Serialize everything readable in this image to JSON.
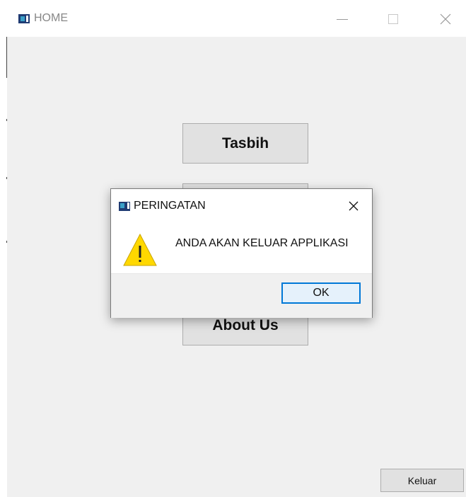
{
  "window": {
    "title": "HOME",
    "icon": "app-window-icon",
    "controls": [
      "minimize-icon",
      "maximize-icon",
      "close-icon"
    ]
  },
  "main": {
    "buttons": [
      {
        "label": "Tasbih"
      },
      {
        "label": ""
      },
      {
        "label": ""
      },
      {
        "label": "About Us"
      }
    ],
    "exit_button": "Keluar"
  },
  "dialog": {
    "title": "PERINGATAN",
    "message": "ANDA AKAN KELUAR APPLIKASI",
    "icon": "warning-icon",
    "ok_label": "OK"
  },
  "colors": {
    "window_bg": "#f0f0f0",
    "button_bg": "#e1e1e1",
    "ok_border": "#0078d7",
    "warning_fill": "#ffd800"
  }
}
